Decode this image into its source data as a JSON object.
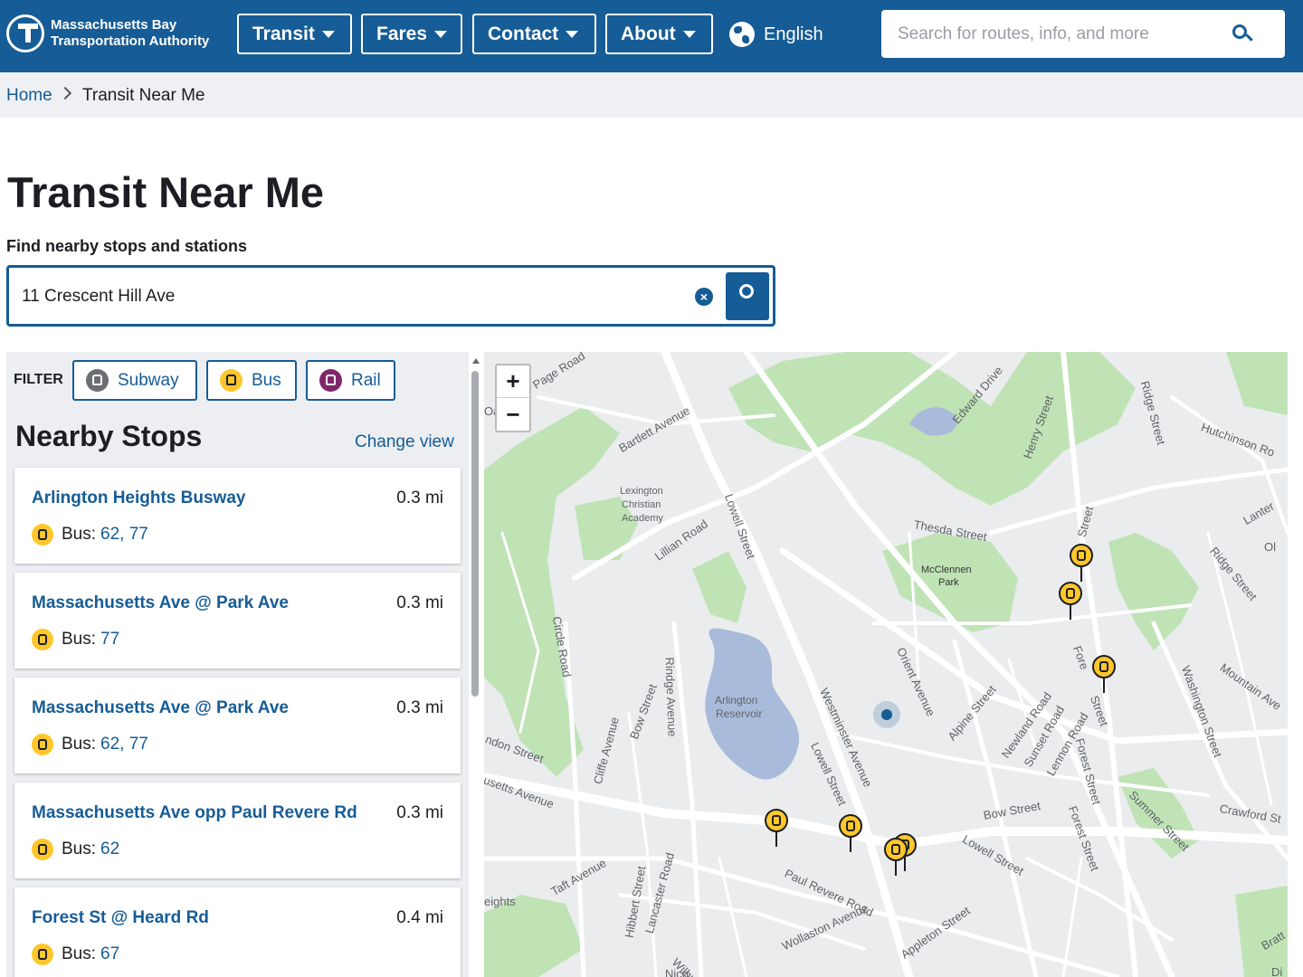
{
  "header": {
    "brand_line1": "Massachusetts Bay",
    "brand_line2": "Transportation Authority",
    "nav": [
      "Transit",
      "Fares",
      "Contact",
      "About"
    ],
    "language": "English",
    "search_placeholder": "Search for routes, info, and more"
  },
  "breadcrumb": {
    "home": "Home",
    "current": "Transit Near Me"
  },
  "page": {
    "title": "Transit Near Me",
    "find_label": "Find nearby stops and stations",
    "address_value": "11 Crescent Hill Ave"
  },
  "filter": {
    "label": "FILTER",
    "chips": [
      "Subway",
      "Bus",
      "Rail"
    ]
  },
  "nearby": {
    "title": "Nearby Stops",
    "change_view": "Change view",
    "stops": [
      {
        "name": "Arlington Heights Busway",
        "distance": "0.3 mi",
        "mode": "Bus:",
        "routes": "62, 77"
      },
      {
        "name": "Massachusetts Ave @ Park Ave",
        "distance": "0.3 mi",
        "mode": "Bus:",
        "routes": "77"
      },
      {
        "name": "Massachusetts Ave @ Park Ave",
        "distance": "0.3 mi",
        "mode": "Bus:",
        "routes": "62, 77"
      },
      {
        "name": "Massachusetts Ave opp Paul Revere Rd",
        "distance": "0.3 mi",
        "mode": "Bus:",
        "routes": "62"
      },
      {
        "name": "Forest St @ Heard Rd",
        "distance": "0.4 mi",
        "mode": "Bus:",
        "routes": "67"
      }
    ]
  },
  "map": {
    "zoom_in": "+",
    "zoom_out": "−",
    "labels": [
      "Page Road",
      "Bartlett Avenue",
      "Edward Drive",
      "Henry Street",
      "Ridge Street",
      "Hutchinson Ro",
      "Lexington",
      "Christian",
      "Academy",
      "Lillian Road",
      "Lowell Street",
      "Thesda Street",
      "McClennen",
      "Park",
      "Lanter",
      "Ol",
      "Ridge Street",
      "Circle Road",
      "Rindge Avenue",
      "Arlington",
      "Reservoir",
      "Orient Avenue",
      "Washington Street",
      "Mountain Ave",
      "Bow Street",
      "ndon Street",
      "Westminster Avenue",
      "Alpine Street",
      "Newland Road",
      "Sunset Road",
      "Lennon Road",
      "Cliffe Avenue",
      "usetts Avenue",
      "Lowell Street",
      "Bow Street",
      "Forest Street",
      "Summer Street",
      "Crawford St",
      "Lowell Street",
      "Paul Revere Road",
      "Taft Avenue",
      "eights",
      "Hibbert Street",
      "Lancaster Road",
      "Wollaston Avenue",
      "Appleton Street",
      "Wilbur Av",
      "Nico",
      "Bratt",
      "Di",
      "Forest Street",
      "Oa",
      "Street",
      "Fore",
      "Street"
    ]
  },
  "colors": {
    "brand": "#165c96",
    "bus": "#ffc72c",
    "rail": "#80276c",
    "subway": "#6b6e73",
    "park": "#bfe3b5",
    "water": "#a9bbdb"
  }
}
